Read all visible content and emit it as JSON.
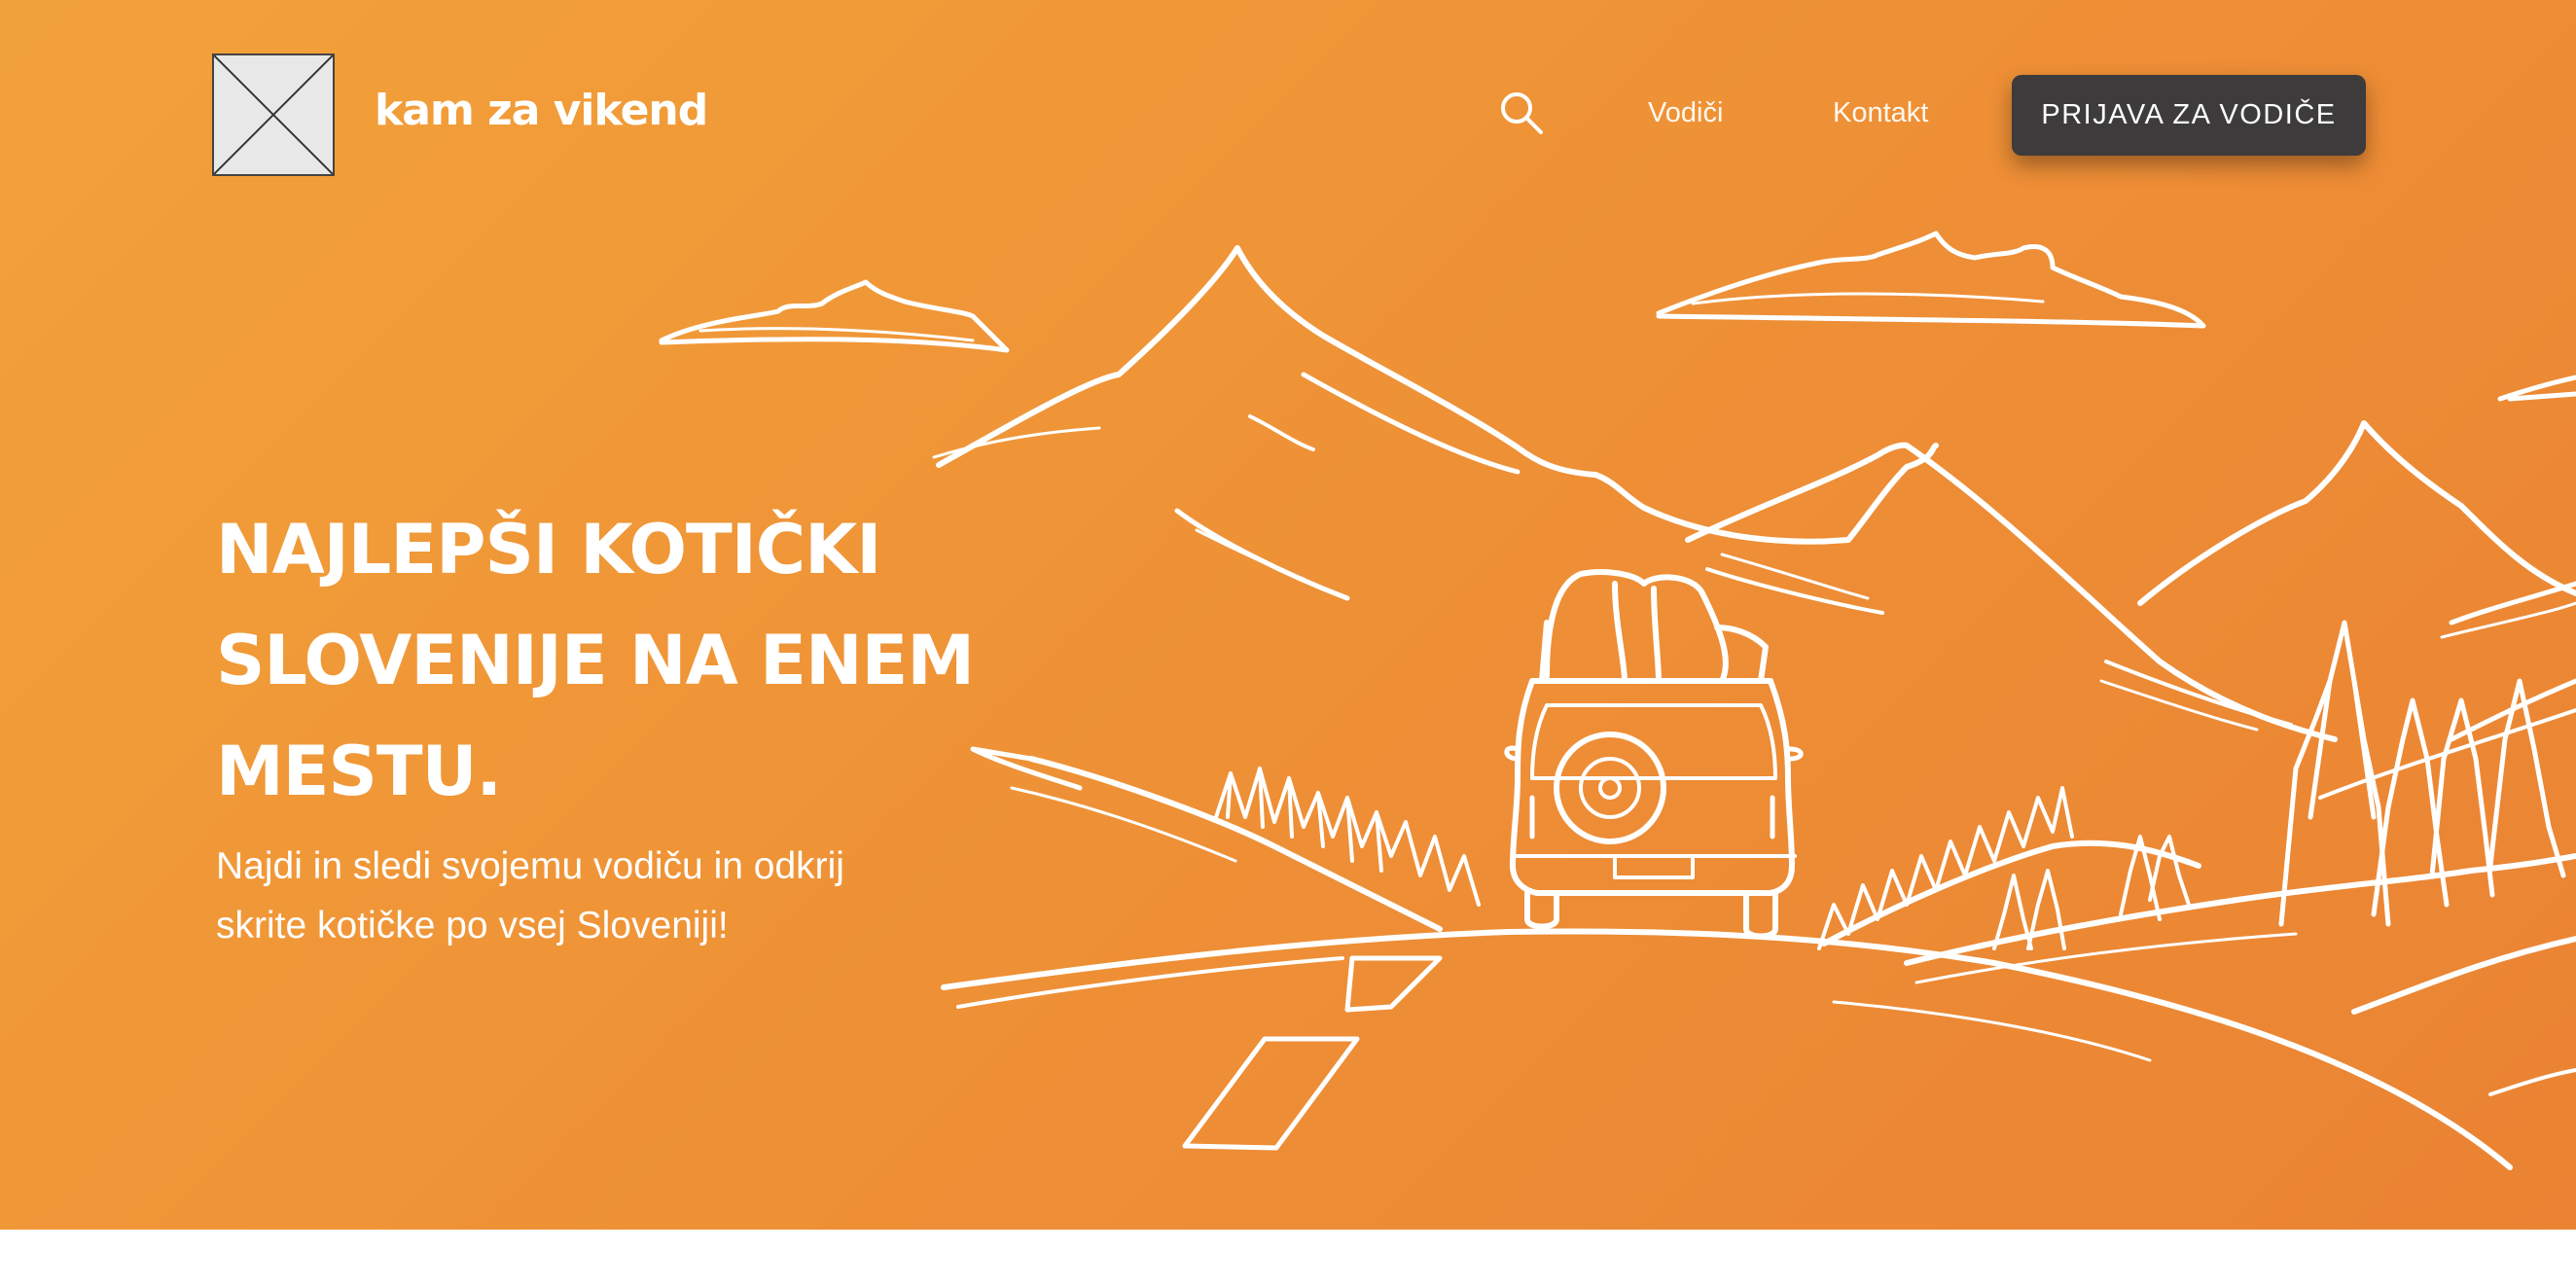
{
  "brand": {
    "name": "kam za vikend",
    "logo": "placeholder-image"
  },
  "nav": {
    "search_icon": "search-icon",
    "links": [
      {
        "label": "Vodiči"
      },
      {
        "label": "Kontakt"
      }
    ],
    "cta_label": "PRIJAVA ZA VODIČE"
  },
  "hero": {
    "headline_lines": [
      "NAJLEPŠI KOTIČKI",
      "SLOVENIJE NA ENEM",
      "MESTU."
    ],
    "subtext_lines": [
      "Najdi in sledi svojemu vodiču in odkrij",
      "skrite kotičke po vsej Sloveniji!"
    ],
    "illustration": "line-drawing-car-mountains-road"
  },
  "colors": {
    "hero_gradient_start": "#f2a23a",
    "hero_gradient_end": "#ea8333",
    "cta_background": "#3d3b3c",
    "text": "#ffffff"
  }
}
